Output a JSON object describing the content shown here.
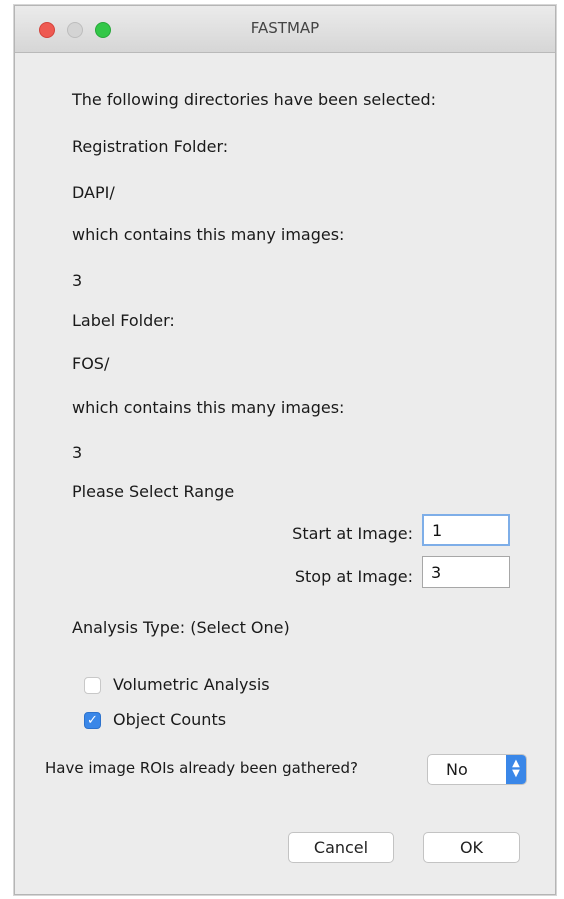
{
  "window": {
    "title": "FASTMAP"
  },
  "lines": {
    "intro": "The following directories have been selected:",
    "reg_label": "Registration Folder:",
    "reg_folder": "DAPI/",
    "reg_count_label": "which contains this many images:",
    "reg_count": "3",
    "label_label": "Label Folder:",
    "label_folder": "FOS/",
    "label_count_label": "which contains this many images:",
    "label_count": "3",
    "range_heading": "Please Select Range"
  },
  "range": {
    "start_label": "Start at Image:",
    "start_value": "1",
    "stop_label": "Stop at Image:",
    "stop_value": "3"
  },
  "analysis": {
    "heading": "Analysis Type: (Select One)",
    "options": [
      {
        "label": "Volumetric Analysis",
        "checked": false
      },
      {
        "label": "Object Counts",
        "checked": true
      }
    ]
  },
  "roi": {
    "question": "Have image ROIs already been gathered?",
    "selected": "No"
  },
  "buttons": {
    "cancel": "Cancel",
    "ok": "OK"
  },
  "colors": {
    "accent": "#3a87e8",
    "close": "#ee5a52",
    "maximize": "#33c748"
  }
}
